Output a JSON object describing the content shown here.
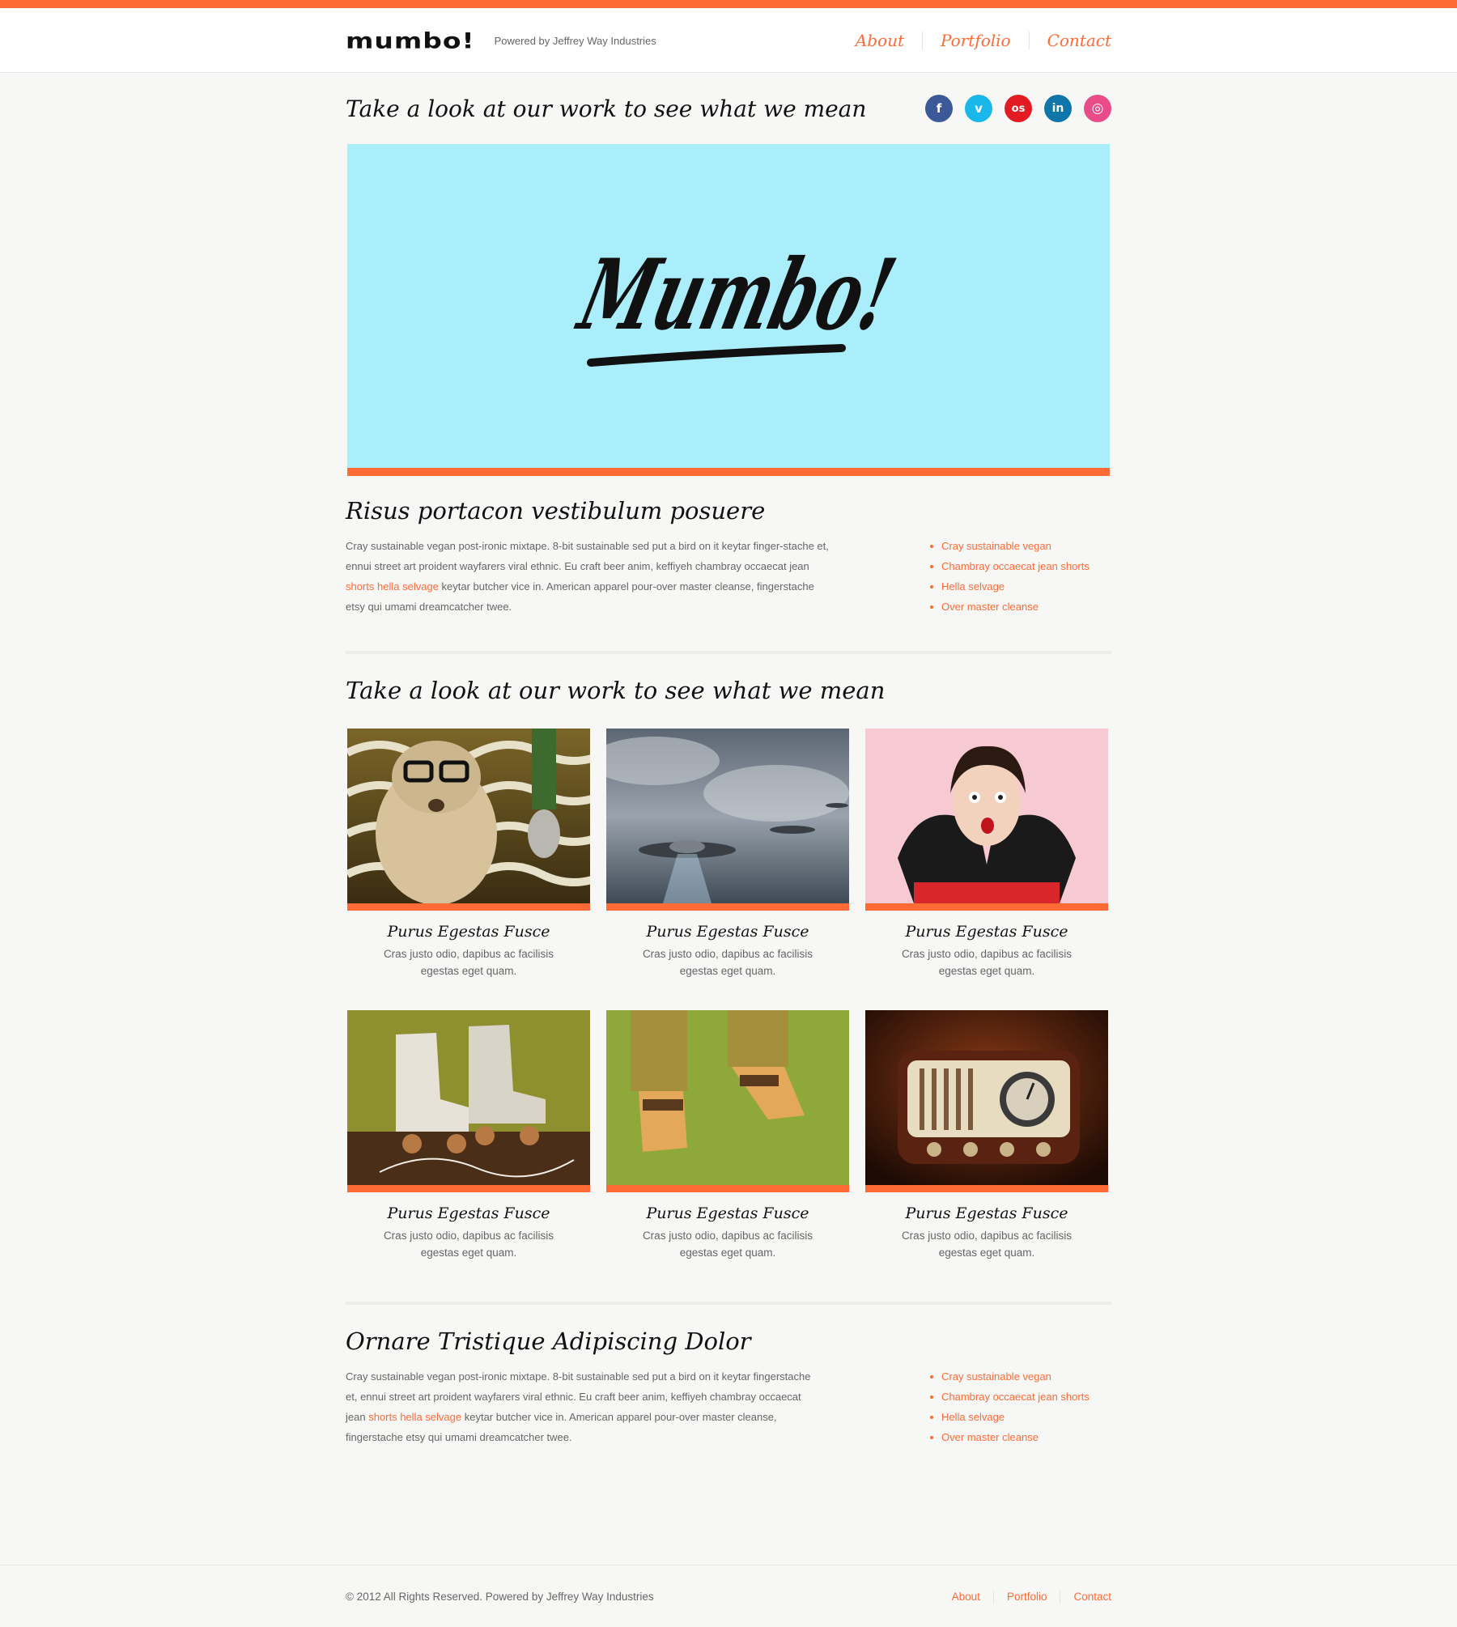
{
  "header": {
    "logo": "mumbo!",
    "powered": "Powered by Jeffrey Way Industries",
    "nav": [
      "About",
      "Portfolio",
      "Contact"
    ]
  },
  "tagline": "Take a look at our work to see what we mean",
  "social": [
    {
      "icon": "facebook-icon",
      "glyph": "f",
      "color": "#3b5998"
    },
    {
      "icon": "vimeo-icon",
      "glyph": "v",
      "color": "#1ab7ea"
    },
    {
      "icon": "lastfm-icon",
      "glyph": "os",
      "color": "#e31b23"
    },
    {
      "icon": "linkedin-icon",
      "glyph": "in",
      "color": "#0e76a8"
    },
    {
      "icon": "dribbble-icon",
      "glyph": "◎",
      "color": "#ea4c89"
    }
  ],
  "hero": {
    "logo_text": "Mumbo!",
    "bg": "#aaeefc"
  },
  "section1": {
    "title": "Risus portacon vestibulum posuere",
    "text_before": "Cray sustainable vegan post-ironic mixtape. 8-bit sustainable sed put a bird on it keytar finger-stache et, ennui street art proident wayfarers viral ethnic. Eu craft beer anim, keffiyeh chambray occaecat jean ",
    "link": "shorts hella selvage",
    "text_after": " keytar butcher vice in. American apparel pour-over master cleanse, fingerstache etsy qui umami dreamcatcher twee.",
    "bullets": [
      "Cray sustainable vegan",
      "Chambray occaecat jean shorts",
      "Hella selvage",
      "Over master cleanse"
    ]
  },
  "portfolio": {
    "title": "Take a look at our work to see what we mean",
    "items": [
      {
        "title": "Purus Egestas Fusce",
        "desc": "Cras justo odio, dapibus ac facilisis egestas eget quam.",
        "image": "dog-with-glasses"
      },
      {
        "title": "Purus Egestas Fusce",
        "desc": "Cras justo odio, dapibus ac facilisis egestas eget quam.",
        "image": "flying-saucers"
      },
      {
        "title": "Purus Egestas Fusce",
        "desc": "Cras justo odio, dapibus ac facilisis egestas eget quam.",
        "image": "surprised-woman"
      },
      {
        "title": "Purus Egestas Fusce",
        "desc": "Cras justo odio, dapibus ac facilisis egestas eget quam.",
        "image": "roller-skates"
      },
      {
        "title": "Purus Egestas Fusce",
        "desc": "Cras justo odio, dapibus ac facilisis egestas eget quam.",
        "image": "retro-shoes"
      },
      {
        "title": "Purus Egestas Fusce",
        "desc": "Cras justo odio, dapibus ac facilisis egestas eget quam.",
        "image": "vintage-radio"
      }
    ]
  },
  "section2": {
    "title": "Ornare Tristique Adipiscing Dolor",
    "text_before": "Cray sustainable vegan post-ironic mixtape. 8-bit sustainable sed put a bird on it keytar fingerstache et, ennui street art proident wayfarers viral ethnic. Eu craft beer anim, keffiyeh chambray occaecat jean ",
    "link": "shorts hella selvage",
    "text_after": " keytar butcher vice in. American apparel pour-over master cleanse, fingerstache etsy qui umami dreamcatcher twee.",
    "bullets": [
      "Cray sustainable vegan",
      "Chambray occaecat jean shorts",
      "Hella selvage",
      "Over master cleanse"
    ]
  },
  "footer": {
    "copyright": "© 2012 All Rights Reserved. Powered by Jeffrey Way Industries",
    "nav": [
      "About",
      "Portfolio",
      "Contact"
    ]
  },
  "colors": {
    "accent": "#ff6b35"
  }
}
